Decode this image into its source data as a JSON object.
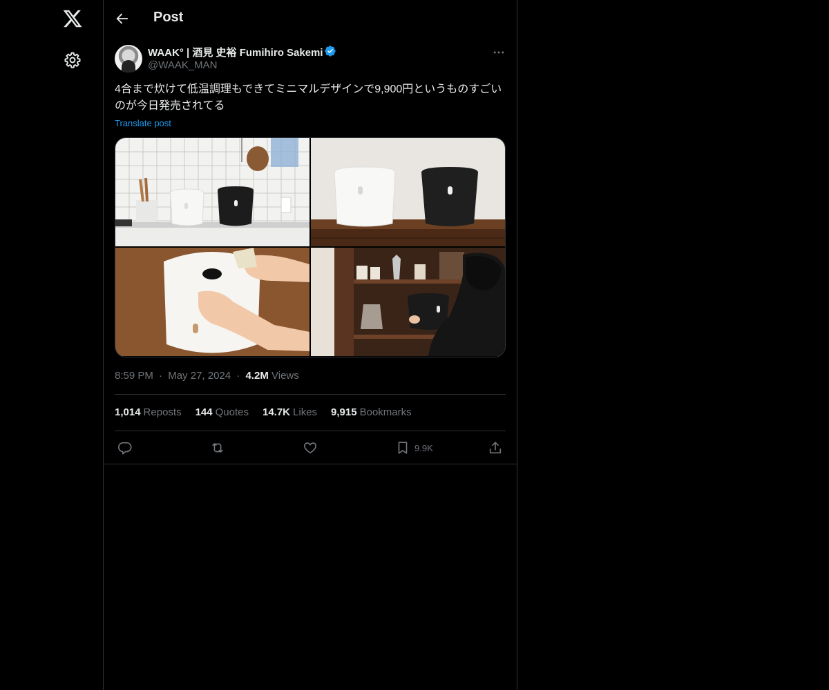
{
  "header": {
    "title": "Post"
  },
  "post": {
    "author_name": "WAAK° | 酒見 史裕 Fumihiro Sakemi",
    "handle": "@WAAK_MAN",
    "text": "4合まで炊けて低温調理もできてミニマルデザインで9,900円というものすごいのが今日発売されてる",
    "translate_label": "Translate post",
    "time": "8:59 PM",
    "date": "May 27, 2024",
    "views_count": "4.2M",
    "views_label": "Views",
    "separator": "·"
  },
  "stats": {
    "reposts_count": "1,014",
    "reposts_label": "Reposts",
    "quotes_count": "144",
    "quotes_label": "Quotes",
    "likes_count": "14.7K",
    "likes_label": "Likes",
    "bookmarks_count": "9,915",
    "bookmarks_label": "Bookmarks"
  },
  "actions": {
    "bookmark_count": "9.9K"
  },
  "icons": {
    "logo": "x-logo-icon",
    "settings": "gear-icon",
    "back": "arrow-left-icon",
    "verified": "verified-badge-icon",
    "more": "more-horizontal-icon",
    "reply": "reply-icon",
    "repost": "repost-icon",
    "like": "heart-icon",
    "bookmark": "bookmark-icon",
    "share": "share-icon"
  },
  "colors": {
    "background": "#000000",
    "text": "#e7e9ea",
    "secondary": "#71767b",
    "accent": "#1d9bf0",
    "border": "#2f3336"
  }
}
